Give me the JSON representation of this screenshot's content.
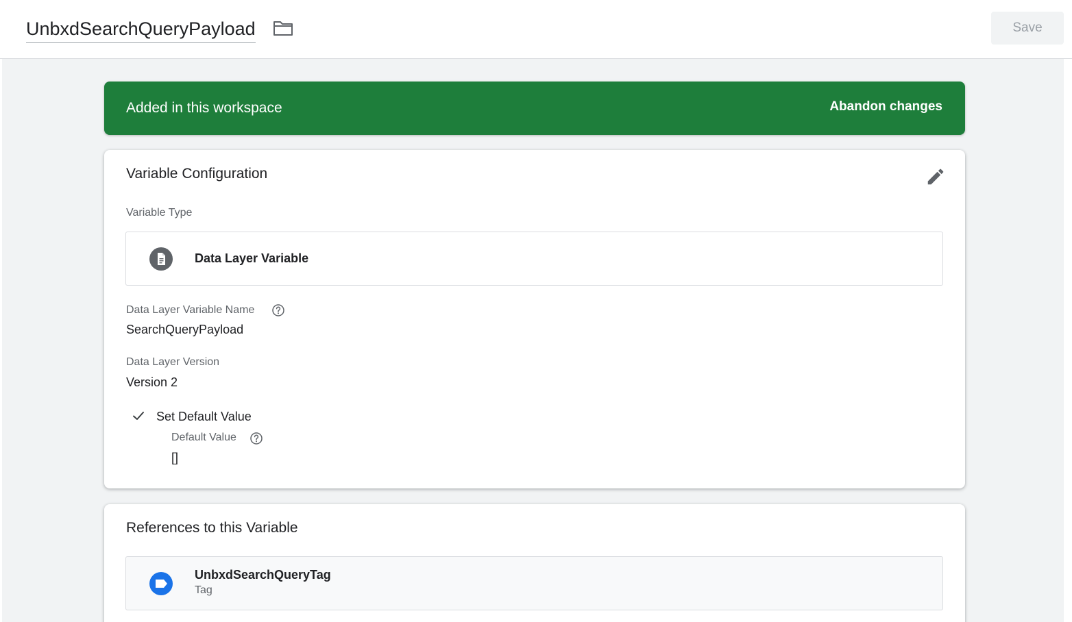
{
  "header": {
    "title": "UnbxdSearchQueryPayload",
    "save_label": "Save",
    "folder_icon": "folder-icon"
  },
  "banner": {
    "message": "Added in this workspace",
    "action_label": "Abandon changes",
    "color": "#1e7e3b"
  },
  "config": {
    "title": "Variable Configuration",
    "edit_icon": "pencil-icon",
    "variable_type_label": "Variable Type",
    "variable_type_value": "Data Layer Variable",
    "variable_type_icon": "document-icon",
    "dlv_name_label": "Data Layer Variable Name",
    "dlv_name_value": "SearchQueryPayload",
    "dl_version_label": "Data Layer Version",
    "dl_version_value": "Version 2",
    "default_value_option": "Set Default Value",
    "default_value_checked": true,
    "default_value_label": "Default Value",
    "default_value_value": "[]"
  },
  "references": {
    "title": "References to this Variable",
    "items": [
      {
        "name": "UnbxdSearchQueryTag",
        "type": "Tag",
        "icon": "tag-icon",
        "icon_color": "#1a73e8"
      }
    ]
  }
}
